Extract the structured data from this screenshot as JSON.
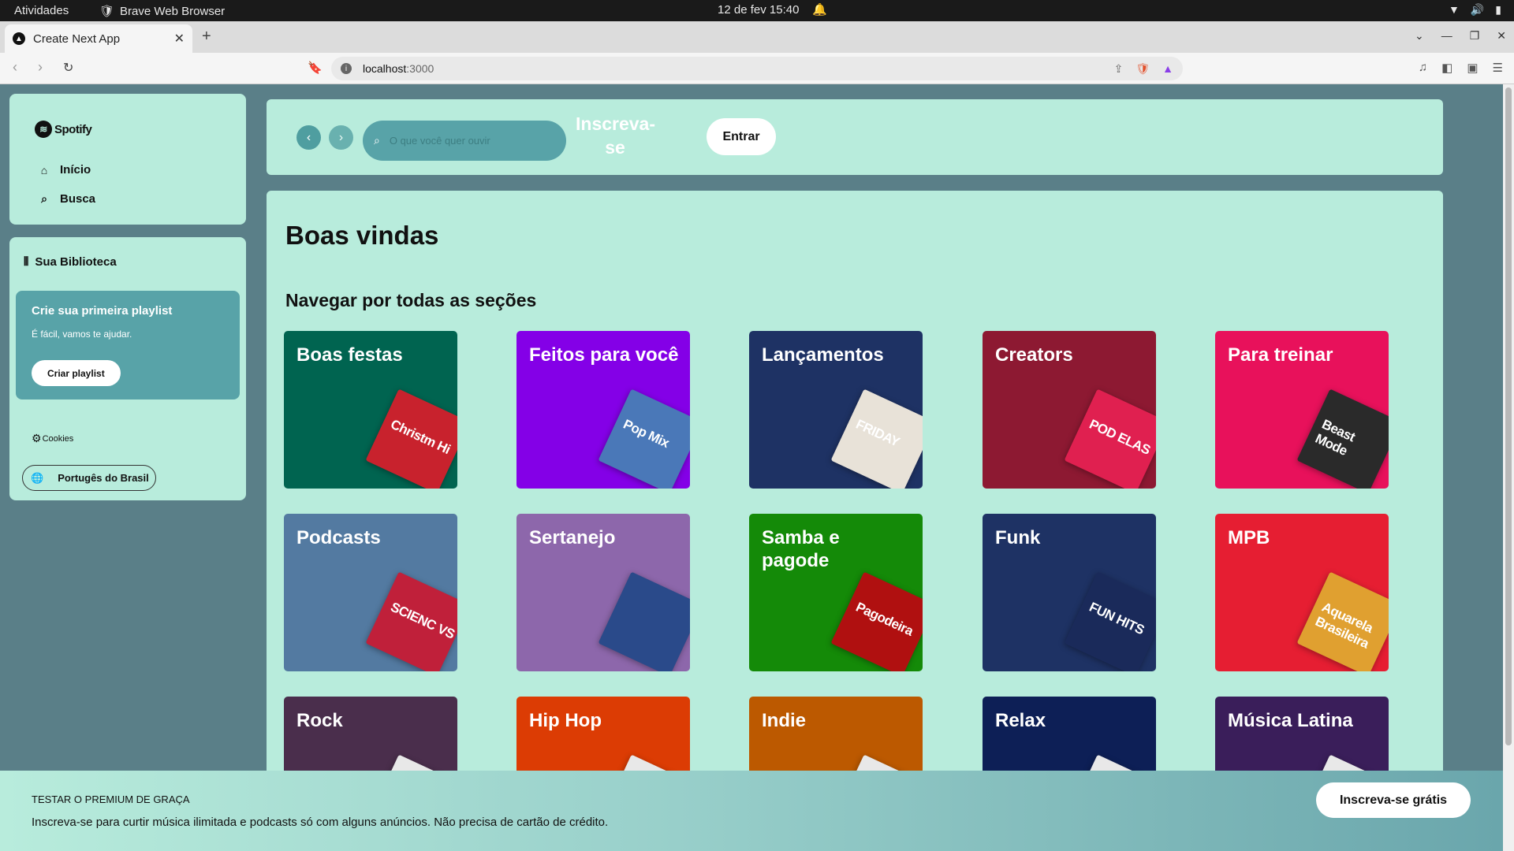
{
  "os": {
    "activities": "Atividades",
    "browser_name": "Brave Web Browser",
    "datetime": "12 de fev  15:40"
  },
  "browser": {
    "tab_title": "Create Next App",
    "url_host": "localhost",
    "url_port": ":3000"
  },
  "sidebar": {
    "logo": "Spotify",
    "nav": [
      {
        "label": "Início",
        "icon": "home-icon"
      },
      {
        "label": "Busca",
        "icon": "search-icon"
      }
    ],
    "library_title": "Sua Biblioteca",
    "playlist_card": {
      "title": "Crie sua primeira playlist",
      "subtitle": "É fácil, vamos te ajudar.",
      "button": "Criar playlist"
    },
    "cookies": "Cookies",
    "language": "Portugês do Brasil"
  },
  "header": {
    "search_placeholder": "O que você quer ouvir",
    "signup_line1": "Inscreva-",
    "signup_line2": "se",
    "login": "Entrar"
  },
  "main": {
    "welcome": "Boas vindas",
    "section_title": "Navegar por todas as seções",
    "cards": [
      {
        "label": "Boas festas",
        "color": "#006450",
        "art_color": "#c8222d",
        "art_text": "Christm Hi"
      },
      {
        "label": "Feitos para você",
        "color": "#8400e7",
        "art_color": "#4a78b8",
        "art_text": "Pop Mix"
      },
      {
        "label": "Lançamentos",
        "color": "#1e3264",
        "art_color": "#e8e2d8",
        "art_text": "FRIDAY"
      },
      {
        "label": "Creators",
        "color": "#8d1932",
        "art_color": "#e02050",
        "art_text": "POD ELAS"
      },
      {
        "label": "Para treinar",
        "color": "#e8115b",
        "art_color": "#2a2a2a",
        "art_text": "Beast Mode"
      },
      {
        "label": "Podcasts",
        "color": "#537aa1",
        "art_color": "#c0203a",
        "art_text": "SCIENC VS"
      },
      {
        "label": "Sertanejo",
        "color": "#8d67ab",
        "art_color": "#2a4a8a",
        "art_text": ""
      },
      {
        "label": "Samba e pagode",
        "color": "#148a08",
        "art_color": "#b01010",
        "art_text": "Pagodeira"
      },
      {
        "label": "Funk",
        "color": "#1e3264",
        "art_color": "#1a2a5a",
        "art_text": "FUN HITS"
      },
      {
        "label": "MPB",
        "color": "#e61e32",
        "art_color": "#e0a030",
        "art_text": "Aquarela Brasileira"
      },
      {
        "label": "Rock",
        "color": "#4a2e4c",
        "art_color": "#e8e8e8",
        "art_text": ""
      },
      {
        "label": "Hip Hop",
        "color": "#dc3c04",
        "art_color": "#e8e8e8",
        "art_text": ""
      },
      {
        "label": "Indie",
        "color": "#bc5900",
        "art_color": "#e8e8e8",
        "art_text": ""
      },
      {
        "label": "Relax",
        "color": "#0d1f56",
        "art_color": "#e8e8e8",
        "art_text": ""
      },
      {
        "label": "Música Latina",
        "color": "#3a1e5a",
        "art_color": "#e8e8e8",
        "art_text": ""
      }
    ]
  },
  "premium": {
    "kicker": "TESTAR O PREMIUM DE GRAÇA",
    "text": "Inscreva-se para curtir música ilimitada e podcasts só com alguns anúncios. Não precisa de cartão de crédito.",
    "button": "Inscreva-se grátis"
  }
}
